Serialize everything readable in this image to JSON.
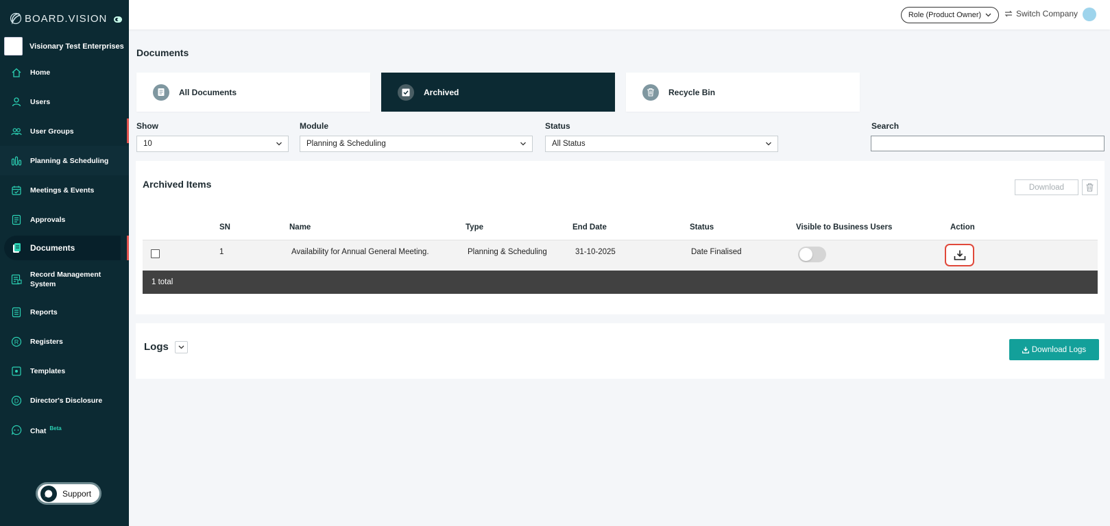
{
  "brand": {
    "name": "BOARD.VISION"
  },
  "company": {
    "name": "Visionary Test Enterprises"
  },
  "sidebar": {
    "items": [
      {
        "label": "Home",
        "icon": "home-icon"
      },
      {
        "label": "Users",
        "icon": "user-icon"
      },
      {
        "label": "User Groups",
        "icon": "user-group-icon"
      },
      {
        "label": "Planning & Scheduling",
        "icon": "bar-chart-icon"
      },
      {
        "label": "Meetings & Events",
        "icon": "calendar-icon"
      },
      {
        "label": "Approvals",
        "icon": "approval-icon"
      },
      {
        "label": "Documents",
        "icon": "document-icon"
      },
      {
        "label": "Record Management System",
        "icon": "record-icon"
      },
      {
        "label": "Reports",
        "icon": "report-icon"
      },
      {
        "label": "Registers",
        "icon": "registered-icon"
      },
      {
        "label": "Templates",
        "icon": "template-icon"
      },
      {
        "label": "Director's Disclosure",
        "icon": "disclosure-icon"
      },
      {
        "label": "Chat",
        "icon": "chat-icon",
        "badge": "Beta"
      }
    ],
    "active": "Documents",
    "support_label": "Support"
  },
  "topbar": {
    "role": "Role (Product Owner)",
    "switch_company": "Switch Company"
  },
  "page": {
    "title": "Documents"
  },
  "tabs": [
    {
      "label": "All Documents",
      "icon": "document-icon"
    },
    {
      "label": "Archived",
      "icon": "checkbox-icon",
      "active": true
    },
    {
      "label": "Recycle Bin",
      "icon": "trash-icon"
    }
  ],
  "filters": {
    "show_label": "Show",
    "show_value": "10",
    "module_label": "Module",
    "module_value": "Planning & Scheduling",
    "status_label": "Status",
    "status_value": "All Status",
    "search_label": "Search",
    "search_value": ""
  },
  "archived": {
    "title": "Archived Items",
    "download_label": "Download",
    "columns": [
      "SN",
      "Name",
      "Type",
      "End Date",
      "Status",
      "Visible to Business Users",
      "Action"
    ],
    "rows": [
      {
        "sn": "1",
        "name": "Availability for Annual General Meeting.",
        "type": "Planning & Scheduling",
        "end_date": "31-10-2025",
        "status": "Date Finalised",
        "visible": false
      }
    ],
    "total": "1 total"
  },
  "logs": {
    "title": "Logs",
    "download_label": "Download Logs"
  },
  "colors": {
    "sidebar_bg": "#0c2a33",
    "accent_teal": "#13a09a",
    "active_marker": "#e2544f",
    "highlight_border": "#e0483a"
  }
}
